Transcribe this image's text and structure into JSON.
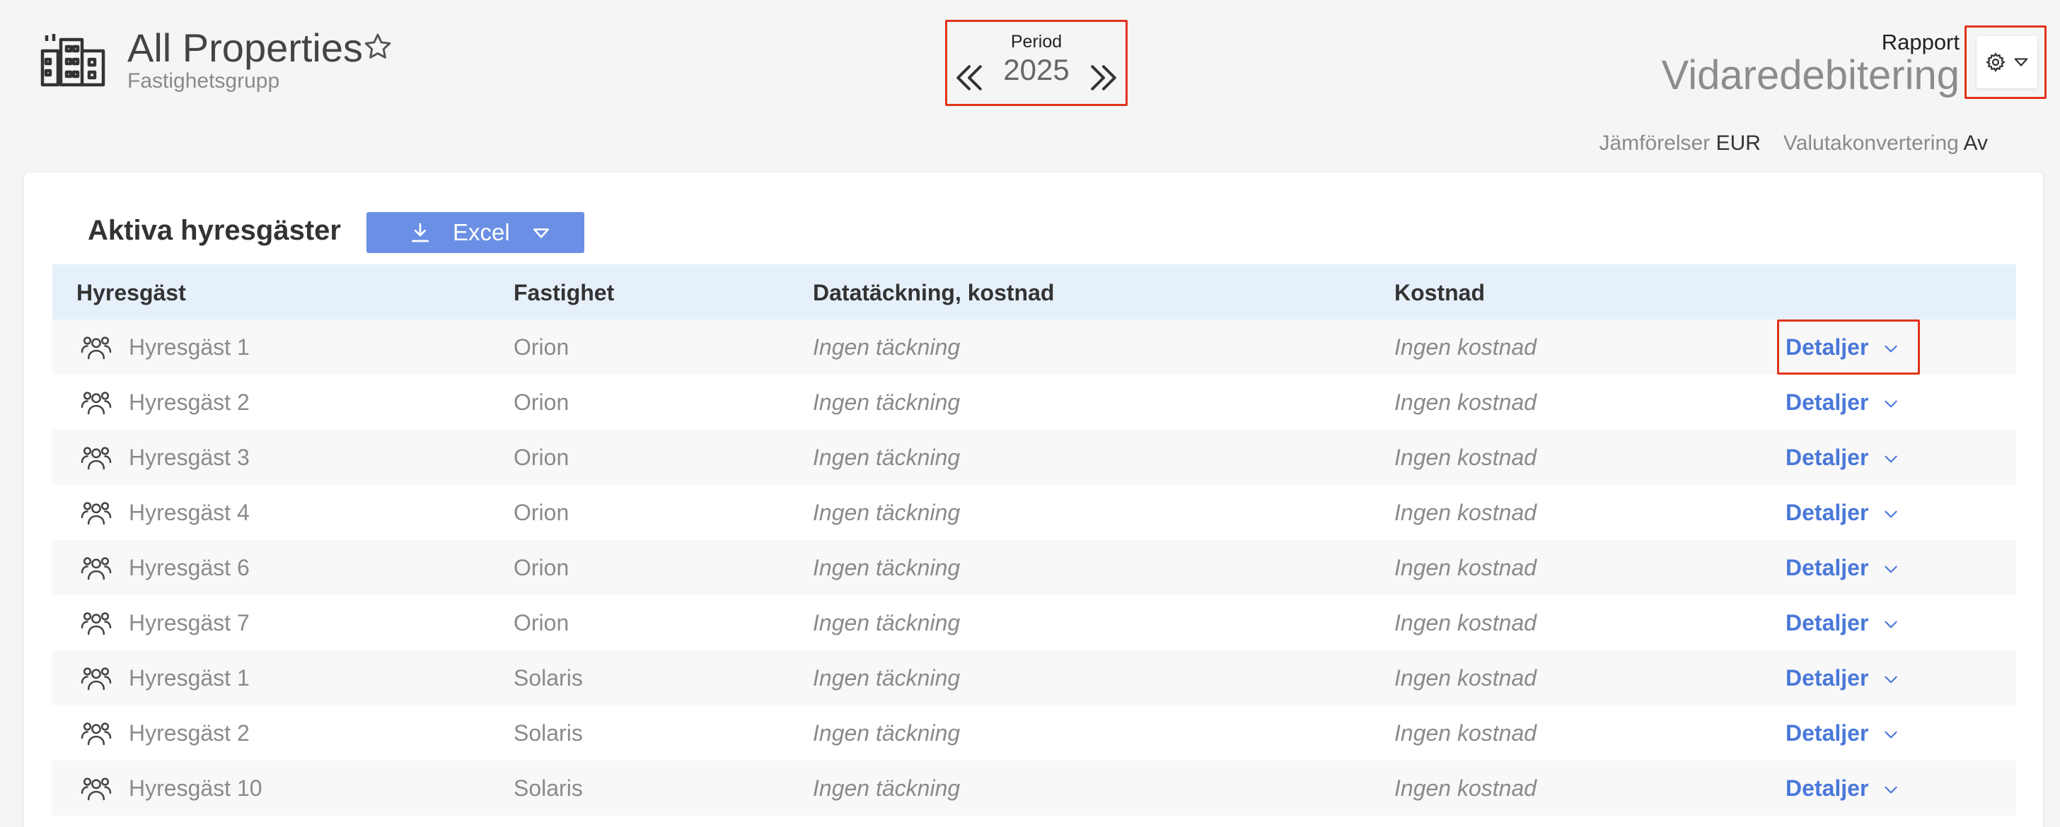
{
  "header": {
    "property_title": "All Properties",
    "property_subtitle": "Fastighetsgrupp",
    "period_label": "Period",
    "period_value": "2025",
    "report_label": "Rapport",
    "report_name": "Vidaredebitering",
    "comparisons_label": "Jämförelser",
    "comparisons_value": "EUR",
    "currency_conv_label": "Valutakonvertering",
    "currency_conv_value": "Av"
  },
  "card": {
    "title": "Aktiva hyresgäster",
    "excel_label": "Excel"
  },
  "table": {
    "columns": [
      "Hyresgäst",
      "Fastighet",
      "Datatäckning, kostnad",
      "Kostnad"
    ],
    "rows": [
      {
        "tenant": "Hyresgäst 1",
        "property": "Orion",
        "coverage": "Ingen täckning",
        "cost": "Ingen kostnad",
        "action": "Detaljer"
      },
      {
        "tenant": "Hyresgäst 2",
        "property": "Orion",
        "coverage": "Ingen täckning",
        "cost": "Ingen kostnad",
        "action": "Detaljer"
      },
      {
        "tenant": "Hyresgäst 3",
        "property": "Orion",
        "coverage": "Ingen täckning",
        "cost": "Ingen kostnad",
        "action": "Detaljer"
      },
      {
        "tenant": "Hyresgäst 4",
        "property": "Orion",
        "coverage": "Ingen täckning",
        "cost": "Ingen kostnad",
        "action": "Detaljer"
      },
      {
        "tenant": "Hyresgäst 6",
        "property": "Orion",
        "coverage": "Ingen täckning",
        "cost": "Ingen kostnad",
        "action": "Detaljer"
      },
      {
        "tenant": "Hyresgäst 7",
        "property": "Orion",
        "coverage": "Ingen täckning",
        "cost": "Ingen kostnad",
        "action": "Detaljer"
      },
      {
        "tenant": "Hyresgäst 1",
        "property": "Solaris",
        "coverage": "Ingen täckning",
        "cost": "Ingen kostnad",
        "action": "Detaljer"
      },
      {
        "tenant": "Hyresgäst 2",
        "property": "Solaris",
        "coverage": "Ingen täckning",
        "cost": "Ingen kostnad",
        "action": "Detaljer"
      },
      {
        "tenant": "Hyresgäst 10",
        "property": "Solaris",
        "coverage": "Ingen täckning",
        "cost": "Ingen kostnad",
        "action": "Detaljer"
      }
    ]
  },
  "icons": {
    "property": "building-group-icon",
    "favorite": "star-icon",
    "prev": "chevron-double-left-icon",
    "next": "chevron-double-right-icon",
    "settings": "gear-icon",
    "download": "download-icon",
    "tenant": "users-icon",
    "expand": "chevron-down-icon"
  },
  "colors": {
    "accent": "#6b8fe5",
    "link": "#4a78d9",
    "highlight": "#e1331c",
    "header_row": "#e6f0fb"
  }
}
